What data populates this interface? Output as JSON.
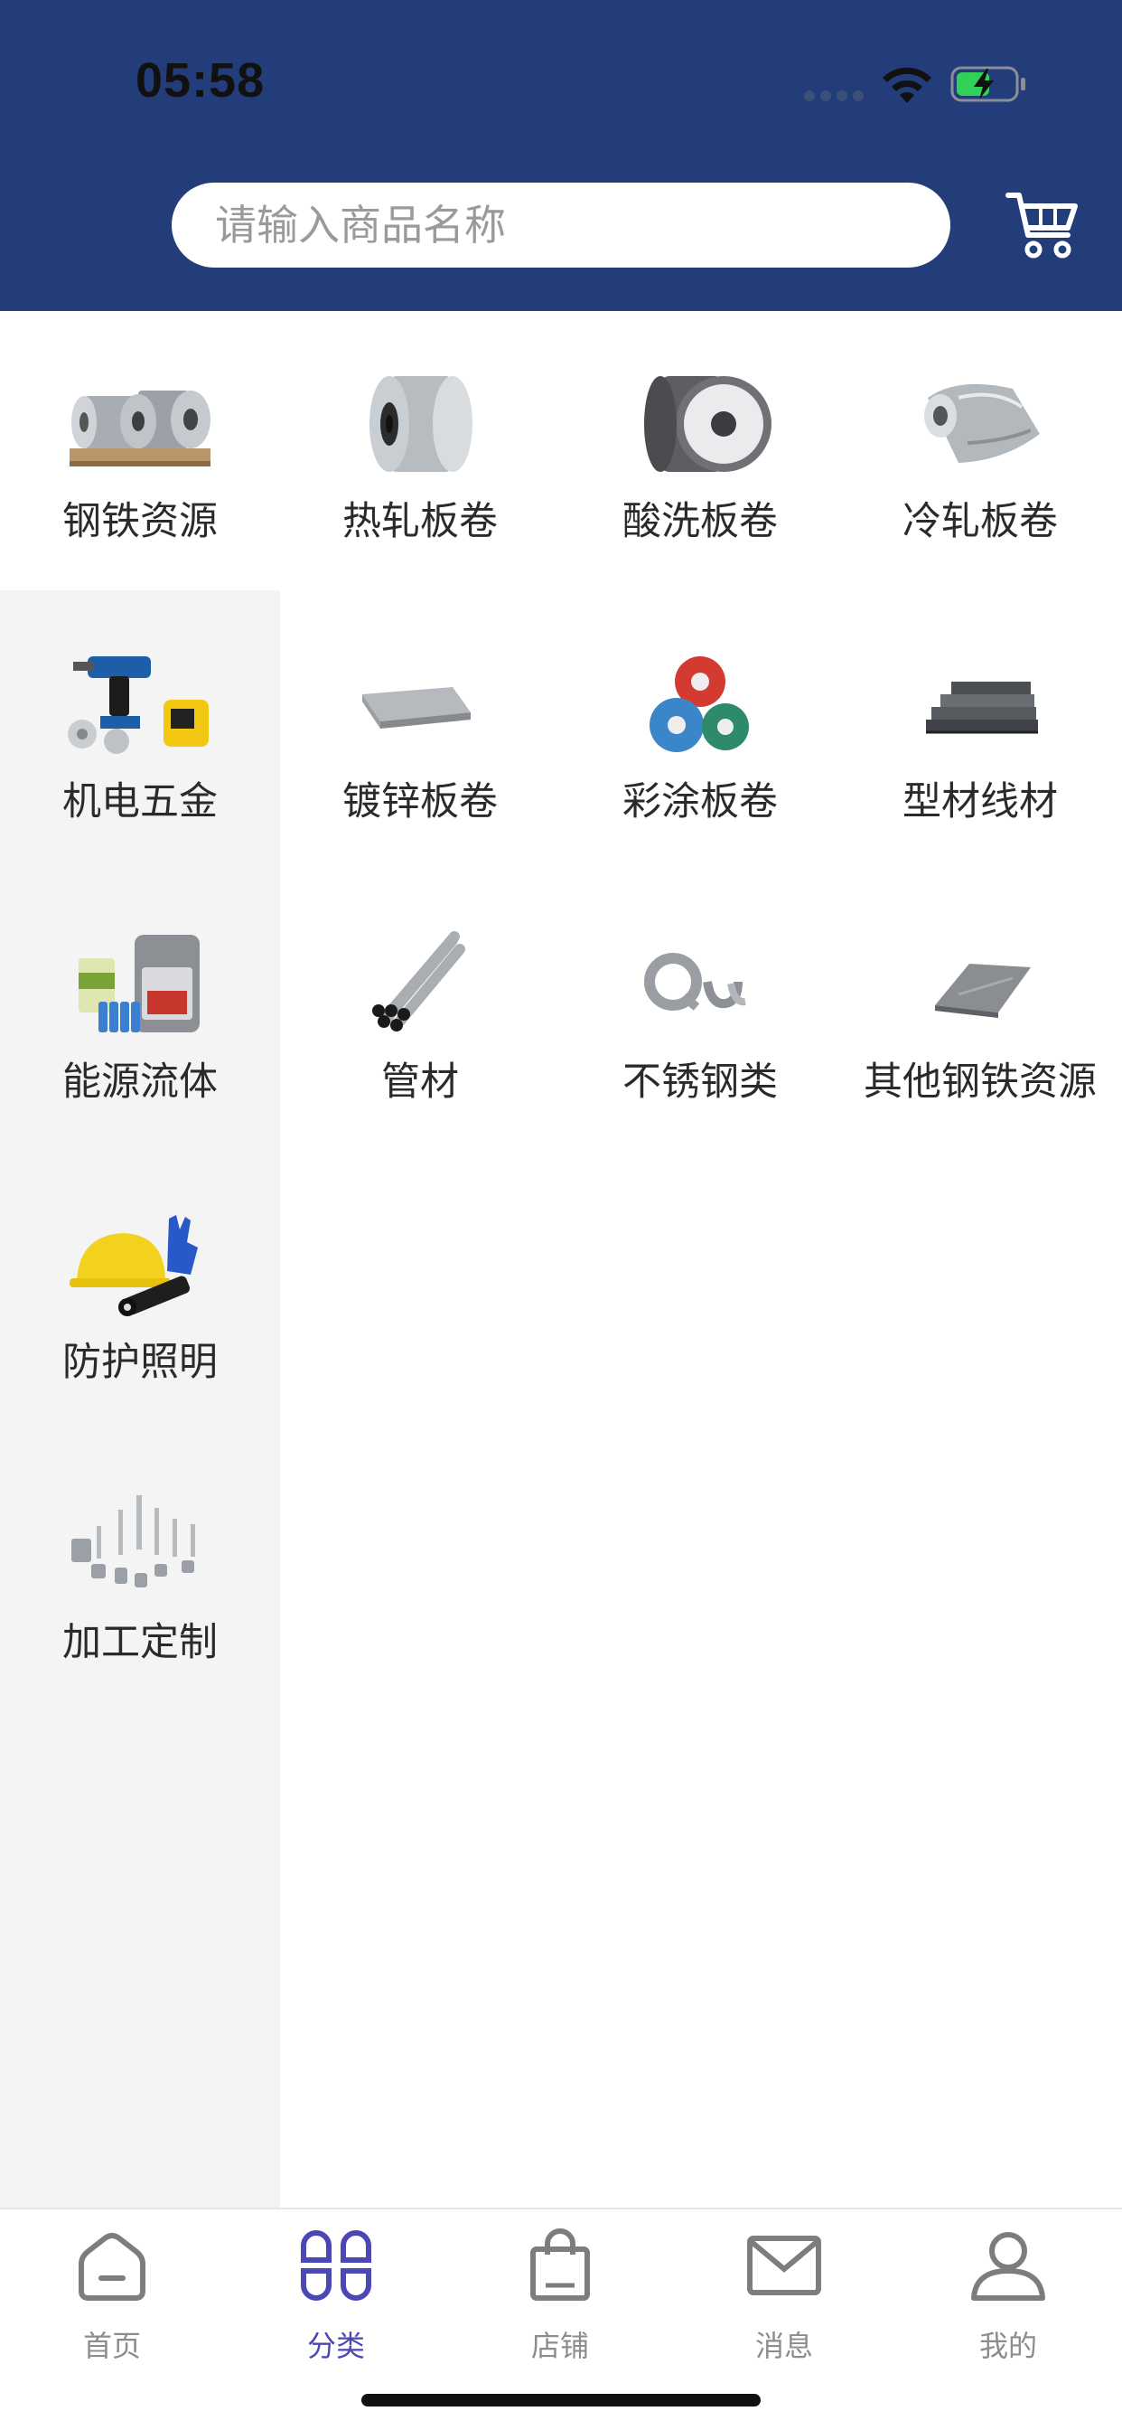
{
  "status_bar": {
    "time": "05:58"
  },
  "search": {
    "placeholder": "请输入商品名称"
  },
  "header": {
    "cart_icon": "shopping-cart-icon"
  },
  "colors": {
    "header_bg": "#233d7a",
    "active_tab": "#4b47b3",
    "sidebar_bg": "#f4f4f4"
  },
  "categories": [
    {
      "label": "钢铁资源",
      "icon": "steel-coils-icon"
    },
    {
      "label": "热轧板卷",
      "icon": "hot-rolled-coil-icon"
    },
    {
      "label": "酸洗板卷",
      "icon": "pickled-coil-icon"
    },
    {
      "label": "冷轧板卷",
      "icon": "cold-rolled-coil-icon"
    },
    {
      "label": "机电五金",
      "icon": "power-tools-icon"
    },
    {
      "label": "镀锌板卷",
      "icon": "galvanized-sheet-icon"
    },
    {
      "label": "彩涂板卷",
      "icon": "color-coated-coil-icon"
    },
    {
      "label": "型材线材",
      "icon": "steel-profiles-icon"
    },
    {
      "label": "能源流体",
      "icon": "oil-paint-cans-icon"
    },
    {
      "label": "管材",
      "icon": "steel-pipes-icon"
    },
    {
      "label": "不锈钢类",
      "icon": "stainless-strips-icon"
    },
    {
      "label": "其他钢铁资源",
      "icon": "steel-plate-icon"
    },
    {
      "label": "防护照明",
      "icon": "helmet-flashlight-icon"
    },
    {
      "label": "加工定制",
      "icon": "machined-parts-icon"
    }
  ],
  "tabs": [
    {
      "label": "首页",
      "icon": "home-icon",
      "active": false
    },
    {
      "label": "分类",
      "icon": "category-grid-icon",
      "active": true
    },
    {
      "label": "店铺",
      "icon": "shopping-bag-icon",
      "active": false
    },
    {
      "label": "消息",
      "icon": "envelope-icon",
      "active": false
    },
    {
      "label": "我的",
      "icon": "user-icon",
      "active": false
    }
  ]
}
